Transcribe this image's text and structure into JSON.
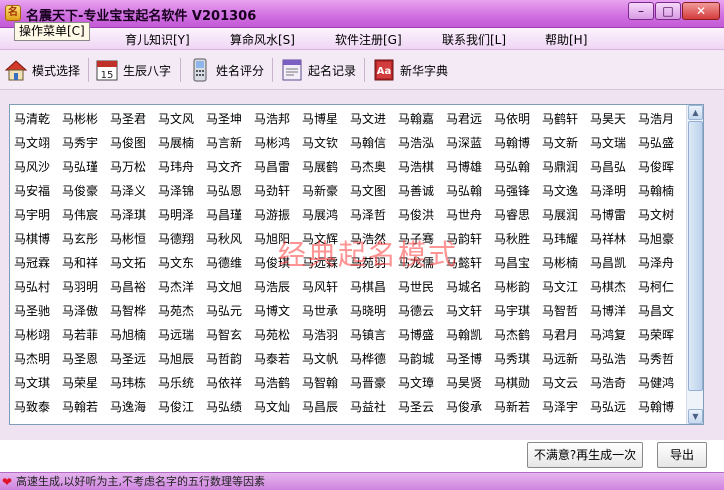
{
  "window": {
    "title": "名震天下-专业宝宝起名软件 V201306",
    "minimize": "–",
    "maximize": "□",
    "close": "✕"
  },
  "menu": {
    "ops_popup": "操作菜单[C]",
    "items": [
      "育儿知识[Y]",
      "算命风水[S]",
      "软件注册[G]",
      "联系我们[L]",
      "帮助[H]"
    ]
  },
  "toolbar": [
    {
      "label": "模式选择",
      "icon": "house-icon"
    },
    {
      "label": "生辰八字",
      "icon": "calendar-icon"
    },
    {
      "label": "姓名评分",
      "icon": "phone-icon"
    },
    {
      "label": "起名记录",
      "icon": "record-icon"
    },
    {
      "label": "新华字典",
      "icon": "dictionary-icon"
    }
  ],
  "watermark": "经典起名模式",
  "names": [
    [
      "马清乾",
      "马彬彬",
      "马圣君",
      "马文风",
      "马圣坤",
      "马浩邦",
      "马博星",
      "马文进",
      "马翰嘉",
      "马君远",
      "马依明",
      "马鹤轩",
      "马昊天",
      "马浩月"
    ],
    [
      "马文翊",
      "马秀宇",
      "马俊图",
      "马展楠",
      "马言新",
      "马彬鸿",
      "马文钦",
      "马翰信",
      "马浩泓",
      "马深蓝",
      "马翰博",
      "马文新",
      "马文瑞",
      "马弘盛"
    ],
    [
      "马风沙",
      "马弘瑾",
      "马万松",
      "马玮舟",
      "马文齐",
      "马昌雷",
      "马展鹤",
      "马杰奥",
      "马浩棋",
      "马博雄",
      "马弘翰",
      "马鼎润",
      "马昌弘",
      "马俊晖"
    ],
    [
      "马安福",
      "马俊豪",
      "马泽义",
      "马泽锦",
      "马弘恩",
      "马劲轩",
      "马新豪",
      "马文图",
      "马善诚",
      "马弘翰",
      "马强锋",
      "马文逸",
      "马泽明",
      "马翰楠"
    ],
    [
      "马宇明",
      "马伟宸",
      "马泽琪",
      "马明泽",
      "马昌瑾",
      "马游振",
      "马展鸿",
      "马泽哲",
      "马俊洪",
      "马世舟",
      "马睿思",
      "马展润",
      "马博雷",
      "马文树"
    ],
    [
      "马棋博",
      "马玄彤",
      "马彬恒",
      "马德翔",
      "马秋风",
      "马旭阳",
      "马文辉",
      "马浩然",
      "马子骞",
      "马韵轩",
      "马秋胜",
      "马玮耀",
      "马祥林",
      "马旭豪"
    ],
    [
      "马冠霖",
      "马和祥",
      "马文拓",
      "马文东",
      "马德维",
      "马俊琪",
      "马远霖",
      "马苑羽",
      "马龙儒",
      "马懿轩",
      "马昌宝",
      "马彬楠",
      "马昌凯",
      "马泽舟"
    ],
    [
      "马弘村",
      "马羽明",
      "马昌裕",
      "马杰洋",
      "马文旭",
      "马浩辰",
      "马风轩",
      "马棋昌",
      "马世民",
      "马城名",
      "马彬韵",
      "马文江",
      "马棋杰",
      "马柯仁"
    ],
    [
      "马圣驰",
      "马泽傲",
      "马智桦",
      "马苑杰",
      "马弘元",
      "马博文",
      "马世承",
      "马晓明",
      "马德云",
      "马文轩",
      "马宇琪",
      "马智哲",
      "马博洋",
      "马昌文"
    ],
    [
      "马彬翊",
      "马若菲",
      "马旭楠",
      "马远瑞",
      "马智玄",
      "马苑松",
      "马浩羽",
      "马镇言",
      "马博盛",
      "马翰凯",
      "马杰鹤",
      "马君月",
      "马鸿复",
      "马荣晖"
    ],
    [
      "马杰明",
      "马圣恩",
      "马圣远",
      "马旭辰",
      "马哲韵",
      "马泰若",
      "马文帆",
      "马桦德",
      "马韵城",
      "马圣博",
      "马秀琪",
      "马远新",
      "马弘浩",
      "马秀哲"
    ],
    [
      "马文琪",
      "马荣星",
      "马玮栋",
      "马乐统",
      "马依祥",
      "马浩鹤",
      "马智翰",
      "马晋豪",
      "马文璋",
      "马昊贤",
      "马棋勋",
      "马文云",
      "马浩奇",
      "马健鸿"
    ],
    [
      "马致泰",
      "马翰若",
      "马逸海",
      "马俊江",
      "马弘绩",
      "马文灿",
      "马昌辰",
      "马益社",
      "马圣云",
      "马俊承",
      "马新若",
      "马泽宇",
      "马弘远",
      "马翰博"
    ]
  ],
  "buttons": {
    "regen": "不满意?再生成一次",
    "export": "导出"
  },
  "status": "高速生成,以好听为主,不考虑名字的五行数理等因素"
}
